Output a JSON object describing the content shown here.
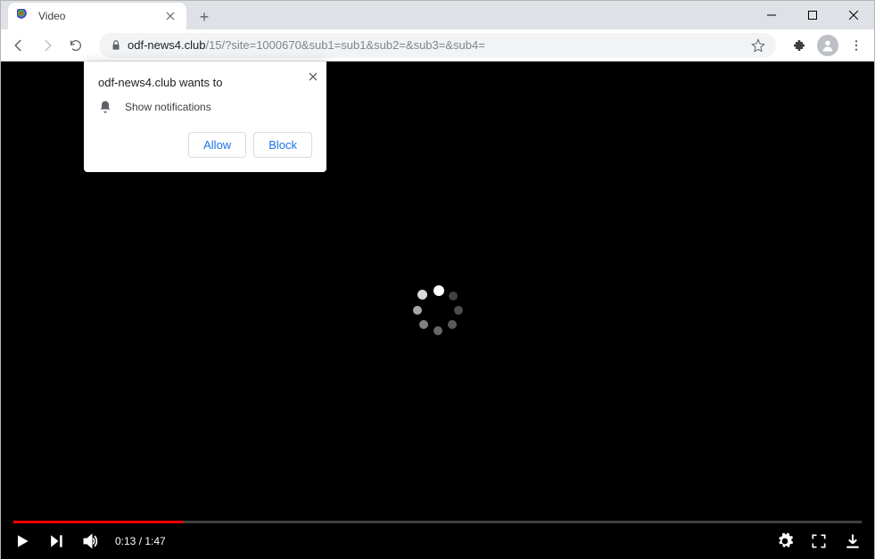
{
  "browser": {
    "tab_title": "Video",
    "url_host": "odf-news4.club",
    "url_path": "/15/?site=1000670&sub1=sub1&sub2=&sub3=&sub4="
  },
  "permission": {
    "title": "odf-news4.club wants to",
    "capability": "Show notifications",
    "allow_label": "Allow",
    "block_label": "Block"
  },
  "player": {
    "current_time": "0:13",
    "duration": "1:47",
    "progress_percent": 20
  }
}
